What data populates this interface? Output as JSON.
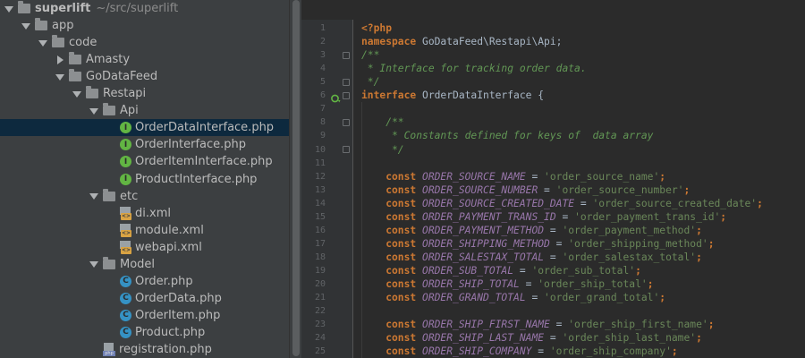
{
  "project_tree": {
    "rows": [
      {
        "label": "superlift",
        "path": "~/src/superlift",
        "depth": 0,
        "arrow": "down",
        "icon": "folder",
        "root": true
      },
      {
        "label": "app",
        "depth": 1,
        "arrow": "down",
        "icon": "folder"
      },
      {
        "label": "code",
        "depth": 2,
        "arrow": "down",
        "icon": "folder"
      },
      {
        "label": "Amasty",
        "depth": 3,
        "arrow": "right",
        "icon": "folder"
      },
      {
        "label": "GoDataFeed",
        "depth": 3,
        "arrow": "down",
        "icon": "folder"
      },
      {
        "label": "Restapi",
        "depth": 4,
        "arrow": "down",
        "icon": "folder"
      },
      {
        "label": "Api",
        "depth": 5,
        "arrow": "down",
        "icon": "folder"
      },
      {
        "label": "OrderDataInterface.php",
        "depth": 6,
        "arrow": "none",
        "icon": "interface",
        "selected": true
      },
      {
        "label": "OrderInterface.php",
        "depth": 6,
        "arrow": "none",
        "icon": "interface"
      },
      {
        "label": "OrderItemInterface.php",
        "depth": 6,
        "arrow": "none",
        "icon": "interface"
      },
      {
        "label": "ProductInterface.php",
        "depth": 6,
        "arrow": "none",
        "icon": "interface"
      },
      {
        "label": "etc",
        "depth": 5,
        "arrow": "down",
        "icon": "folder"
      },
      {
        "label": "di.xml",
        "depth": 6,
        "arrow": "none",
        "icon": "xml"
      },
      {
        "label": "module.xml",
        "depth": 6,
        "arrow": "none",
        "icon": "xml"
      },
      {
        "label": "webapi.xml",
        "depth": 6,
        "arrow": "none",
        "icon": "xml"
      },
      {
        "label": "Model",
        "depth": 5,
        "arrow": "down",
        "icon": "folder"
      },
      {
        "label": "Order.php",
        "depth": 6,
        "arrow": "none",
        "icon": "class"
      },
      {
        "label": "OrderData.php",
        "depth": 6,
        "arrow": "none",
        "icon": "class"
      },
      {
        "label": "OrderItem.php",
        "depth": 6,
        "arrow": "none",
        "icon": "class"
      },
      {
        "label": "Product.php",
        "depth": 6,
        "arrow": "none",
        "icon": "class"
      },
      {
        "label": "registration.php",
        "depth": 5,
        "arrow": "none",
        "icon": "php-file"
      }
    ],
    "icon_letters": {
      "interface": "I",
      "class": "C",
      "xml": "<>",
      "php": "php"
    }
  },
  "editor": {
    "lines": [
      {
        "n": "1",
        "tokens": [
          {
            "t": "<?php",
            "c": "tag"
          }
        ]
      },
      {
        "n": "2",
        "tokens": [
          {
            "t": "namespace ",
            "c": "kw"
          },
          {
            "t": "GoDataFeed\\Restapi\\Api;",
            "c": "plain"
          }
        ]
      },
      {
        "n": "3",
        "tokens": [
          {
            "t": "/**",
            "c": "doc"
          }
        ],
        "fold": true
      },
      {
        "n": "4",
        "tokens": [
          {
            "t": " * Interface for tracking order data.",
            "c": "doc"
          }
        ]
      },
      {
        "n": "5",
        "tokens": [
          {
            "t": " */",
            "c": "doc"
          }
        ],
        "fold": true
      },
      {
        "n": "6",
        "tokens": [
          {
            "t": "interface ",
            "c": "kw"
          },
          {
            "t": "OrderDataInterface {",
            "c": "plain"
          }
        ],
        "fold": true,
        "impl": true
      },
      {
        "n": "7",
        "tokens": []
      },
      {
        "n": "8",
        "tokens": [
          {
            "t": "    /**",
            "c": "doc"
          }
        ],
        "fold": true
      },
      {
        "n": "9",
        "tokens": [
          {
            "t": "     * Constants defined for keys of  data array",
            "c": "doc"
          }
        ]
      },
      {
        "n": "10",
        "tokens": [
          {
            "t": "     */",
            "c": "doc"
          }
        ],
        "fold": true
      },
      {
        "n": "11",
        "tokens": []
      },
      {
        "n": "12",
        "tokens": [
          {
            "t": "    const ",
            "c": "kw"
          },
          {
            "t": "ORDER_SOURCE_NAME",
            "c": "const"
          },
          {
            "t": " = ",
            "c": "plain"
          },
          {
            "t": "'order_source_name'",
            "c": "str"
          },
          {
            "t": ";",
            "c": "kw"
          }
        ]
      },
      {
        "n": "13",
        "tokens": [
          {
            "t": "    const ",
            "c": "kw"
          },
          {
            "t": "ORDER_SOURCE_NUMBER",
            "c": "const"
          },
          {
            "t": " = ",
            "c": "plain"
          },
          {
            "t": "'order_source_number'",
            "c": "str"
          },
          {
            "t": ";",
            "c": "kw"
          }
        ]
      },
      {
        "n": "14",
        "tokens": [
          {
            "t": "    const ",
            "c": "kw"
          },
          {
            "t": "ORDER_SOURCE_CREATED_DATE",
            "c": "const"
          },
          {
            "t": " = ",
            "c": "plain"
          },
          {
            "t": "'order_source_created_date'",
            "c": "str"
          },
          {
            "t": ";",
            "c": "kw"
          }
        ]
      },
      {
        "n": "15",
        "tokens": [
          {
            "t": "    const ",
            "c": "kw"
          },
          {
            "t": "ORDER_PAYMENT_TRANS_ID",
            "c": "const"
          },
          {
            "t": " = ",
            "c": "plain"
          },
          {
            "t": "'order_payment_trans_id'",
            "c": "str"
          },
          {
            "t": ";",
            "c": "kw"
          }
        ]
      },
      {
        "n": "16",
        "tokens": [
          {
            "t": "    const ",
            "c": "kw"
          },
          {
            "t": "ORDER_PAYMENT_METHOD",
            "c": "const"
          },
          {
            "t": " = ",
            "c": "plain"
          },
          {
            "t": "'order_payment_method'",
            "c": "str"
          },
          {
            "t": ";",
            "c": "kw"
          }
        ]
      },
      {
        "n": "17",
        "tokens": [
          {
            "t": "    const ",
            "c": "kw"
          },
          {
            "t": "ORDER_SHIPPING_METHOD",
            "c": "const"
          },
          {
            "t": " = ",
            "c": "plain"
          },
          {
            "t": "'order_shipping_method'",
            "c": "str"
          },
          {
            "t": ";",
            "c": "kw"
          }
        ]
      },
      {
        "n": "18",
        "tokens": [
          {
            "t": "    const ",
            "c": "kw"
          },
          {
            "t": "ORDER_SALESTAX_TOTAL",
            "c": "const"
          },
          {
            "t": " = ",
            "c": "plain"
          },
          {
            "t": "'order_salestax_total'",
            "c": "str"
          },
          {
            "t": ";",
            "c": "kw"
          }
        ]
      },
      {
        "n": "19",
        "tokens": [
          {
            "t": "    const ",
            "c": "kw"
          },
          {
            "t": "ORDER_SUB_TOTAL",
            "c": "const"
          },
          {
            "t": " = ",
            "c": "plain"
          },
          {
            "t": "'order_sub_total'",
            "c": "str"
          },
          {
            "t": ";",
            "c": "kw"
          }
        ]
      },
      {
        "n": "20",
        "tokens": [
          {
            "t": "    const ",
            "c": "kw"
          },
          {
            "t": "ORDER_SHIP_TOTAL",
            "c": "const"
          },
          {
            "t": " = ",
            "c": "plain"
          },
          {
            "t": "'order_ship_total'",
            "c": "str"
          },
          {
            "t": ";",
            "c": "kw"
          }
        ]
      },
      {
        "n": "21",
        "tokens": [
          {
            "t": "    const ",
            "c": "kw"
          },
          {
            "t": "ORDER_GRAND_TOTAL",
            "c": "const"
          },
          {
            "t": " = ",
            "c": "plain"
          },
          {
            "t": "'order_grand_total'",
            "c": "str"
          },
          {
            "t": ";",
            "c": "kw"
          }
        ]
      },
      {
        "n": "22",
        "tokens": []
      },
      {
        "n": "23",
        "tokens": [
          {
            "t": "    const ",
            "c": "kw"
          },
          {
            "t": "ORDER_SHIP_FIRST_NAME",
            "c": "const"
          },
          {
            "t": " = ",
            "c": "plain"
          },
          {
            "t": "'order_ship_first_name'",
            "c": "str"
          },
          {
            "t": ";",
            "c": "kw"
          }
        ]
      },
      {
        "n": "24",
        "tokens": [
          {
            "t": "    const ",
            "c": "kw"
          },
          {
            "t": "ORDER_SHIP_LAST_NAME",
            "c": "const"
          },
          {
            "t": " = ",
            "c": "plain"
          },
          {
            "t": "'order_ship_last_name'",
            "c": "str"
          },
          {
            "t": ";",
            "c": "kw"
          }
        ]
      },
      {
        "n": "25",
        "tokens": [
          {
            "t": "    const ",
            "c": "kw"
          },
          {
            "t": "ORDER_SHIP_COMPANY",
            "c": "const"
          },
          {
            "t": " = ",
            "c": "plain"
          },
          {
            "t": "'order_ship_company'",
            "c": "str"
          },
          {
            "t": ";",
            "c": "kw"
          }
        ]
      }
    ]
  },
  "colors": {
    "tree_bg": "#3c3f41",
    "editor_bg": "#2b2b2b",
    "gutter_bg": "#313335",
    "selection": "#0d293e",
    "keyword": "#cc7832",
    "constant": "#9876aa",
    "string": "#6a8759",
    "doc_comment": "#629755",
    "text": "#a9b7c6"
  }
}
